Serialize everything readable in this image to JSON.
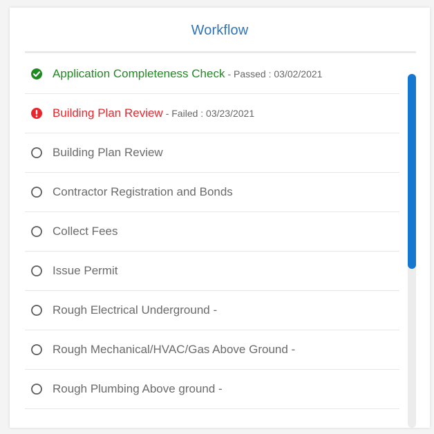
{
  "workflow": {
    "title": "Workflow",
    "colors": {
      "title": "#2f74bb",
      "passed": "#1f8a1f",
      "failed": "#e8262c",
      "scroll_thumb": "#1577cf"
    },
    "items": [
      {
        "name": "Application Completeness Check",
        "detail": "- Passed : 03/02/2021",
        "status": "passed",
        "icon": "check-circle-icon"
      },
      {
        "name": "Building Plan Review",
        "detail": "- Failed : 03/23/2021",
        "status": "failed",
        "icon": "alert-circle-icon"
      },
      {
        "name": "Building Plan Review",
        "detail": "",
        "status": "pending",
        "icon": "empty-circle-icon"
      },
      {
        "name": "Contractor Registration and Bonds",
        "detail": "",
        "status": "pending",
        "icon": "empty-circle-icon"
      },
      {
        "name": "Collect Fees",
        "detail": "",
        "status": "pending",
        "icon": "empty-circle-icon"
      },
      {
        "name": "Issue Permit",
        "detail": "",
        "status": "pending",
        "icon": "empty-circle-icon"
      },
      {
        "name": "Rough Electrical Underground -",
        "detail": "",
        "status": "pending",
        "icon": "empty-circle-icon"
      },
      {
        "name": "Rough Mechanical/HVAC/Gas Above Ground -",
        "detail": "",
        "status": "pending",
        "icon": "empty-circle-icon"
      },
      {
        "name": "Rough Plumbing Above ground -",
        "detail": "",
        "status": "pending",
        "icon": "empty-circle-icon"
      }
    ]
  }
}
